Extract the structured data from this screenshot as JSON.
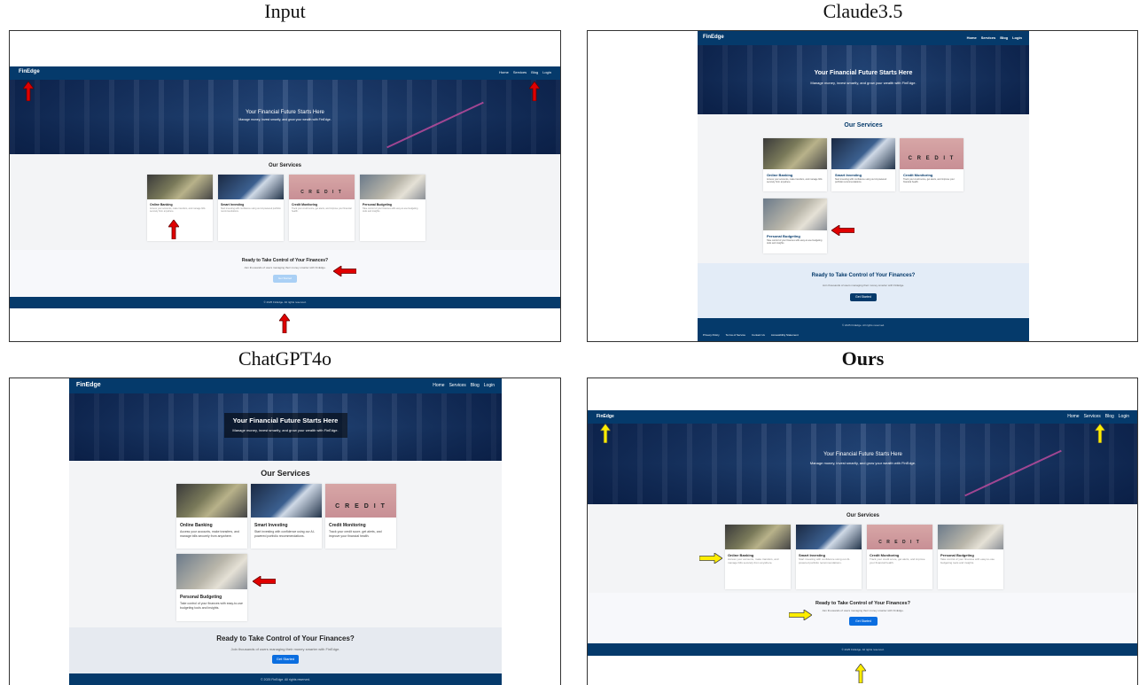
{
  "panels": [
    {
      "caption": "Input"
    },
    {
      "caption": "Claude3.5"
    },
    {
      "caption": "ChatGPT4o"
    },
    {
      "caption": "Ours"
    }
  ],
  "site": {
    "brand": "FinEdge",
    "nav_links": [
      "Home",
      "Services",
      "Blog",
      "Login"
    ],
    "hero_title": "Your Financial Future Starts Here",
    "hero_subtitle": "Manage money, invest smartly, and grow your wealth with FinEdge.",
    "services_title": "Our Services",
    "services": [
      {
        "title": "Online Banking",
        "desc": "Access your accounts, make transfers, and manage bills securely from anywhere.",
        "image": "img-bank"
      },
      {
        "title": "Smart Investing",
        "desc": "Start investing with confidence using our AI-powered portfolio recommendations.",
        "image": "img-invest"
      },
      {
        "title": "Credit Monitoring",
        "desc": "Track your credit score, get alerts, and improve your financial health.",
        "image": "img-credit"
      },
      {
        "title": "Personal Budgeting",
        "desc": "Take control of your finances with easy-to-use budgeting tools and insights.",
        "image": "img-budget"
      }
    ],
    "credit_word": "C R E D I T",
    "cta_title": "Ready to Take Control of Your Finances?",
    "cta_subtitle": "Join thousands of users managing their money smarter with FinEdge.",
    "cta_button": "Get Started",
    "footer": "© 2025 FinEdge. All rights reserved.",
    "footer_links": [
      "Privacy Policy",
      "Terms of Service",
      "Contact Us",
      "Accessibility Statement"
    ]
  },
  "colors": {
    "nav": "#053a6b",
    "button": "#0b6ee0",
    "arrow_red": "#e00000",
    "arrow_yellow": "#ffee00"
  },
  "icons": [
    "arrow-up-icon",
    "arrow-left-icon",
    "arrow-right-icon"
  ]
}
